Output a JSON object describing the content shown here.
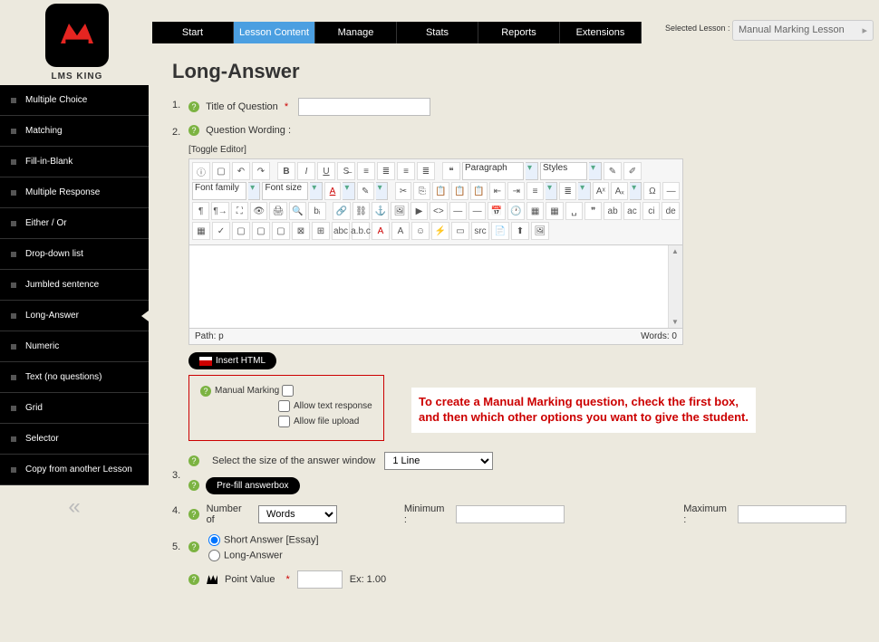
{
  "brand": "LMS KING",
  "sidebar": {
    "items": [
      {
        "label": "Multiple Choice"
      },
      {
        "label": "Matching"
      },
      {
        "label": "Fill-in-Blank"
      },
      {
        "label": "Multiple Response"
      },
      {
        "label": "Either / Or"
      },
      {
        "label": "Drop-down list"
      },
      {
        "label": "Jumbled sentence"
      },
      {
        "label": "Long-Answer"
      },
      {
        "label": "Numeric"
      },
      {
        "label": "Text (no questions)"
      },
      {
        "label": "Grid"
      },
      {
        "label": "Selector"
      },
      {
        "label": "Copy from another Lesson"
      }
    ]
  },
  "nav": {
    "items": [
      {
        "label": "Start"
      },
      {
        "label": "Lesson Content"
      },
      {
        "label": "Manage"
      },
      {
        "label": "Stats"
      },
      {
        "label": "Reports"
      },
      {
        "label": "Extensions"
      }
    ]
  },
  "selectedLessonLabel": "Selected Lesson :",
  "selectedLesson": "Manual Marking Lesson",
  "pageTitle": "Long-Answer",
  "form": {
    "titleLabel": "Title of Question",
    "wordingLabel": "Question Wording :",
    "toggleEditor": "[Toggle Editor]",
    "paragraph": "Paragraph",
    "styles": "Styles",
    "fontFamily": "Font family",
    "fontSize": "Font size",
    "path": "Path: p",
    "words": "Words: 0",
    "insertHtml": "Insert HTML",
    "manualMarking": "Manual Marking",
    "allowText": "Allow text response",
    "allowFile": "Allow file upload",
    "sizeLabel": "Select the size of the answer window",
    "sizeValue": "1 Line",
    "prefill": "Pre-fill answerbox",
    "numberOf": "Number of",
    "numberUnit": "Words",
    "minimum": "Minimum :",
    "maximum": "Maximum :",
    "shortAnswer": "Short Answer [Essay]",
    "longAnswer": "Long-Answer",
    "pointValue": "Point Value",
    "pointEx": "Ex: 1.00"
  },
  "callout": "To create a Manual Marking question, check the first box, and then which other options you want to give the student."
}
